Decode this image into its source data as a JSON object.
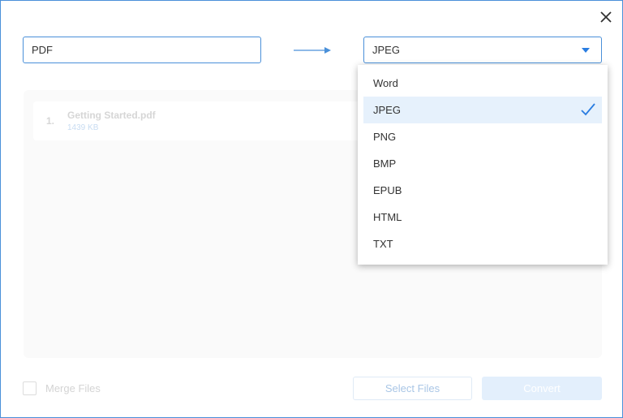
{
  "dialog": {
    "close_icon": "close-icon"
  },
  "source": {
    "value": "PDF"
  },
  "target": {
    "selected": "JPEG"
  },
  "files": [
    {
      "index": "1.",
      "name": "Getting Started.pdf",
      "size": "1439 KB"
    }
  ],
  "dropdown": {
    "options": [
      "Word",
      "JPEG",
      "PNG",
      "BMP",
      "EPUB",
      "HTML",
      "TXT"
    ],
    "selected_option": "JPEG"
  },
  "footer": {
    "merge_label": "Merge Files",
    "select_files_label": "Select Files",
    "convert_label": "Convert"
  },
  "colors": {
    "accent": "#4a90d9",
    "check": "#2a7de1",
    "selected_bg": "#e6f1fc"
  }
}
